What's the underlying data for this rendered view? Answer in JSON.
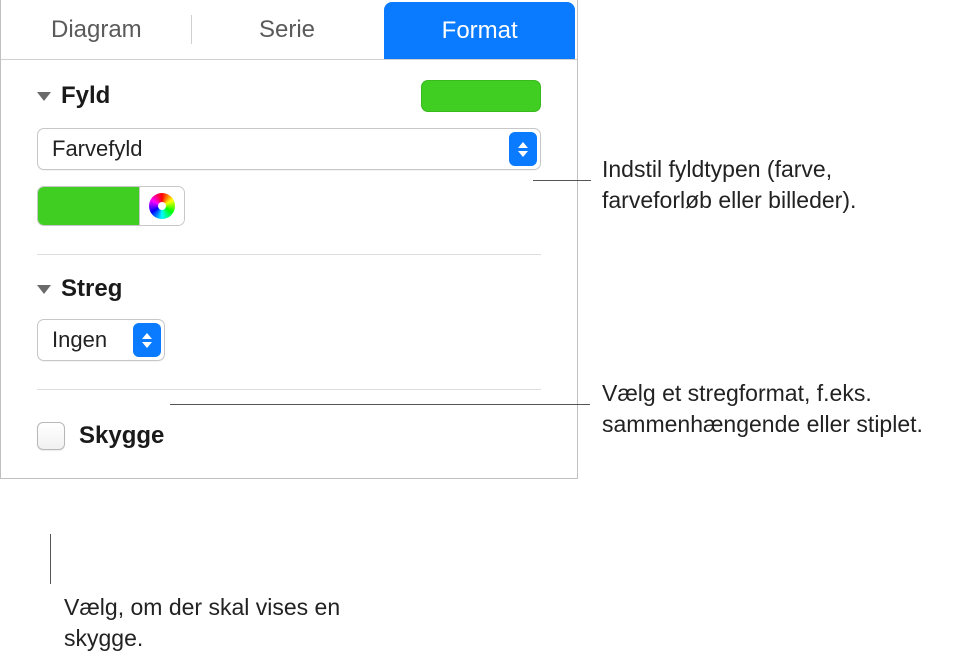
{
  "tabs": {
    "diagram": "Diagram",
    "serie": "Serie",
    "format": "Format"
  },
  "fill": {
    "title": "Fyld",
    "dropdown_value": "Farvefyld",
    "swatch_color": "#3fce21"
  },
  "stroke": {
    "title": "Streg",
    "dropdown_value": "Ingen"
  },
  "shadow": {
    "label": "Skygge"
  },
  "callouts": {
    "fill": "Indstil fyldtypen (farve, farveforløb eller billeder).",
    "stroke": "Vælg et stregformat, f.eks. sammenhængende eller stiplet.",
    "shadow": "Vælg, om der skal vises en skygge."
  }
}
